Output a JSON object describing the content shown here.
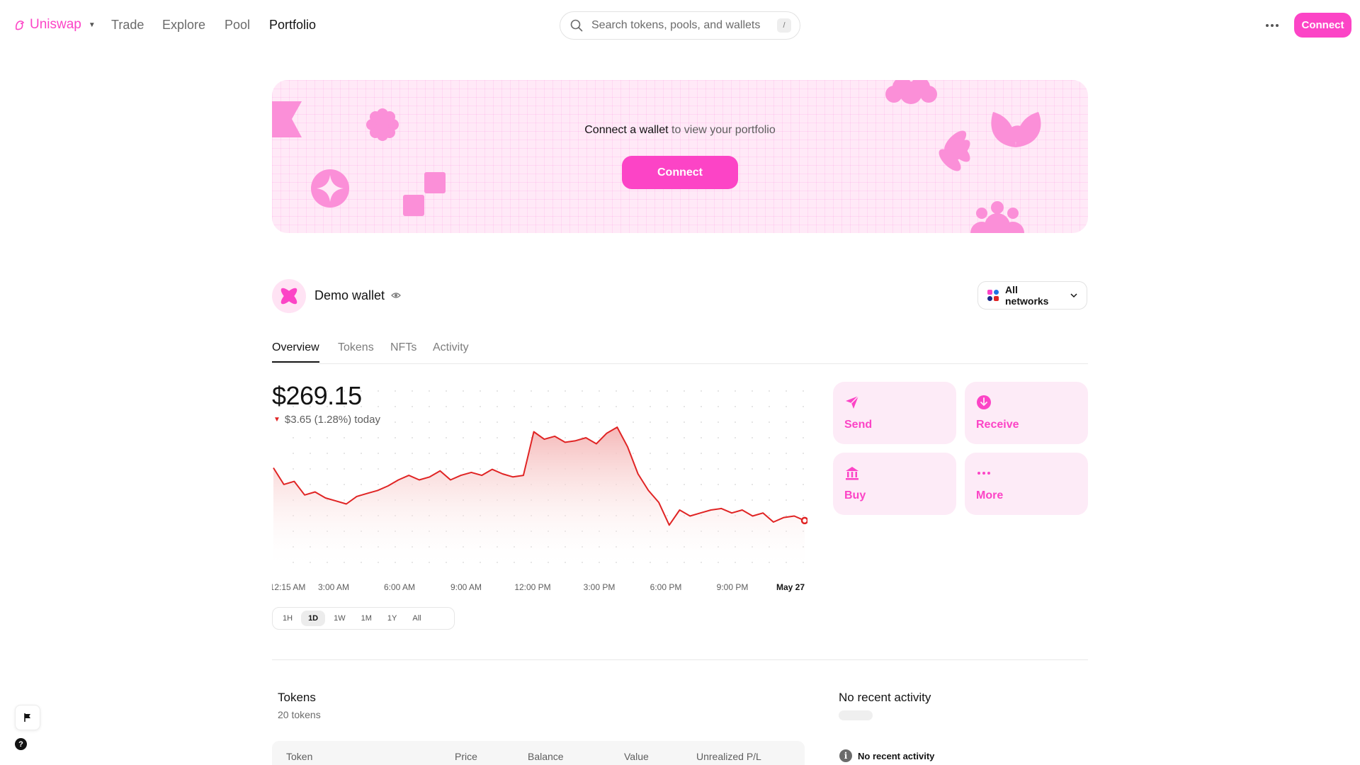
{
  "nav": {
    "brand": "Uniswap",
    "links": [
      "Trade",
      "Explore",
      "Pool",
      "Portfolio"
    ],
    "active_link": "Portfolio",
    "search_placeholder": "Search tokens, pools, and wallets",
    "search_shortcut": "/",
    "connect_label": "Connect"
  },
  "banner": {
    "cta_bold": "Connect a wallet",
    "cta_rest": " to view your portfolio",
    "button_label": "Connect"
  },
  "wallet": {
    "name": "Demo wallet",
    "network_label": "All networks"
  },
  "tabs": [
    "Overview",
    "Tokens",
    "NFTs",
    "Activity"
  ],
  "active_tab": "Overview",
  "balance": {
    "value": "$269.15",
    "change_text": "$3.65 (1.28%) today",
    "direction": "down"
  },
  "actions": [
    {
      "label": "Send",
      "icon": "send-icon"
    },
    {
      "label": "Receive",
      "icon": "receive-icon"
    },
    {
      "label": "Buy",
      "icon": "bank-icon"
    },
    {
      "label": "More",
      "icon": "more-icon"
    }
  ],
  "time_ranges": [
    "1H",
    "1D",
    "1W",
    "1M",
    "1Y",
    "All"
  ],
  "active_time_range": "1D",
  "chart_data": {
    "type": "area",
    "x_tick_labels": [
      "12:15 AM",
      "3:00 AM",
      "6:00 AM",
      "9:00 AM",
      "12:00 PM",
      "3:00 PM",
      "6:00 PM",
      "9:00 PM",
      "May 27"
    ],
    "series": [
      {
        "values": [
          272.8,
          271.7,
          271.9,
          271.0,
          271.2,
          270.8,
          270.6,
          270.4,
          270.9,
          271.1,
          271.3,
          271.6,
          272.0,
          272.3,
          272.0,
          272.2,
          272.6,
          272.0,
          272.3,
          272.5,
          272.3,
          272.7,
          272.4,
          272.2,
          272.3,
          275.2,
          274.7,
          274.9,
          274.5,
          274.6,
          274.8,
          274.4,
          275.1,
          275.5,
          274.2,
          272.4,
          271.3,
          270.5,
          269.0,
          270.0,
          269.6,
          269.8,
          270.0,
          270.1,
          269.8,
          270.0,
          269.6,
          269.8,
          269.2,
          269.5,
          269.6,
          269.3
        ],
        "color": "#e02424"
      }
    ],
    "ylim": [
      266.0,
      278.0
    ],
    "grid": "dotted",
    "line_color": "#e02424",
    "fill_gradient": [
      "#f5b8b8",
      "#ffffff"
    ]
  },
  "tokens": {
    "title": "Tokens",
    "count": "20 tokens",
    "columns": [
      "Token",
      "Price",
      "Balance",
      "Value",
      "Unrealized P/L"
    ]
  },
  "activity": {
    "title": "No recent activity",
    "empty_label": "No recent activity"
  },
  "colors": {
    "accent": "#fc44c6",
    "negative": "#e02424",
    "action_bg": "#fdebf7",
    "banner_bg": "#ffe9f7"
  }
}
